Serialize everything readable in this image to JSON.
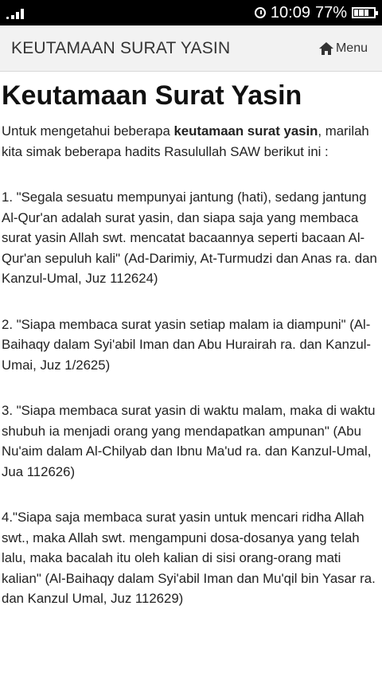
{
  "status_bar": {
    "time": "10:09",
    "battery_percent": "77%",
    "signal_icon": "signal-icon",
    "alarm_icon": "alarm-icon",
    "battery_icon": "battery-icon"
  },
  "header": {
    "title": "KEUTAMAAN SURAT YASIN",
    "menu_label": "Menu",
    "menu_icon": "home-icon"
  },
  "article": {
    "title": "Keutamaan Surat Yasin",
    "intro_before": "Untuk mengetahui beberapa ",
    "intro_bold": "keutamaan surat yasin",
    "intro_after": ", marilah kita simak beberapa hadits Rasulullah SAW berikut ini :",
    "items": [
      "1. \"Segala sesuatu mempunyai jantung (hati), sedang jantung Al-Qur'an adalah surat yasin, dan siapa saja yang membaca surat yasin Allah swt. mencatat bacaannya seperti bacaan Al-Qur'an sepuluh kali\" (Ad-Darimiy, At-Turmudzi dan Anas ra. dan Kanzul-Umal, Juz 112624)",
      "2. \"Siapa membaca surat yasin setiap malam ia diampuni\" (Al-Baihaqy dalam Syi'abil Iman dan Abu Hurairah ra. dan Kanzul-Umai, Juz 1/2625)",
      "3. \"Siapa membaca surat yasin di waktu malam, maka di waktu shubuh ia menjadi orang yang mendapatkan ampunan\" (Abu Nu'aim dalam Al-Chilyab dan Ibnu Ma'ud ra. dan Kanzul-Umal, Jua 112626)",
      "4.\"Siapa saja membaca surat yasin untuk mencari ridha Allah swt., maka Allah swt. mengampuni dosa-dosanya yang telah lalu, maka bacalah itu oleh kalian di sisi orang-orang mati kalian\" (Al-Baihaqy dalam Syi'abil Iman dan Mu'qil bin Yasar ra. dan Kanzul Umal, Juz 112629)"
    ]
  },
  "colors": {
    "status_bar_bg": "#000000",
    "header_bg": "#f2f2f2",
    "text": "#222222"
  }
}
